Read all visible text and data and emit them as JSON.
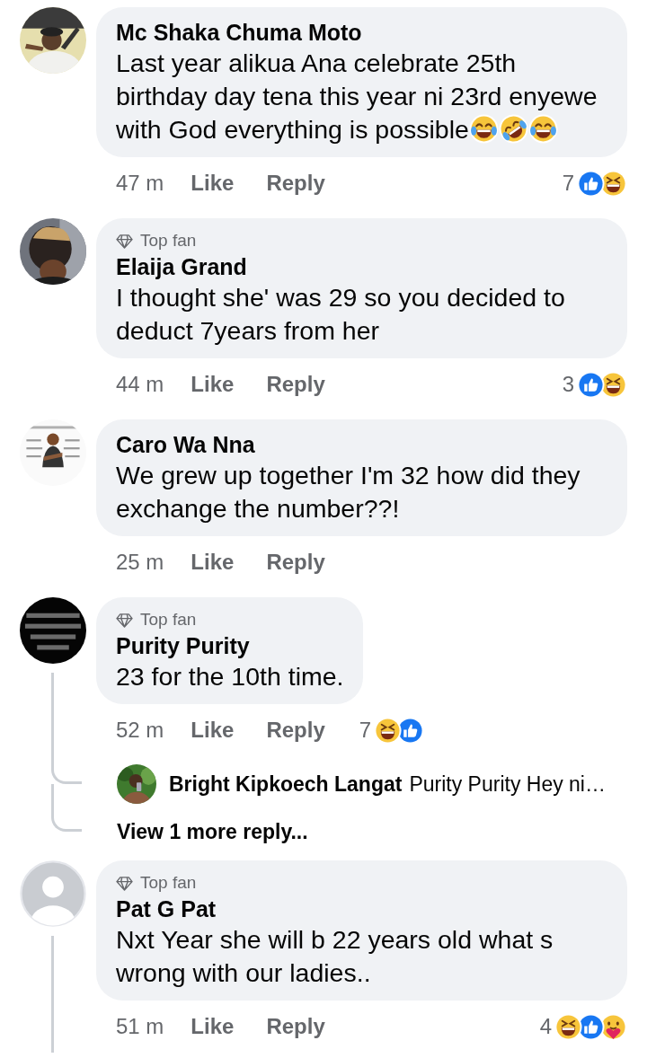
{
  "comments": [
    {
      "avatar": {
        "kind": "picture"
      },
      "name": "Mc Shaka Chuma Moto",
      "text": "Last year alikua Ana celebrate 25th birthday day tena this year ni 23rd enyewe with God everything is possible",
      "emojis": [
        {
          "kind": "joy"
        },
        {
          "kind": "rofl"
        },
        {
          "kind": "joy"
        }
      ],
      "time": "47 m",
      "like": "Like",
      "reply": "Reply",
      "reaction_count": "7",
      "reactions": [
        {
          "kind": "like"
        },
        {
          "kind": "haha"
        }
      ],
      "thread": false
    },
    {
      "avatar": {
        "kind": "picture"
      },
      "badge": "Top fan",
      "name": "Elaija Grand",
      "text": "I thought she' was 29 so you decided to deduct 7years from her",
      "time": "44 m",
      "like": "Like",
      "reply": "Reply",
      "reaction_count": "3",
      "reactions": [
        {
          "kind": "like"
        },
        {
          "kind": "haha"
        }
      ],
      "thread": false
    },
    {
      "avatar": {
        "kind": "picture"
      },
      "name": "Caro Wa Nna",
      "text": "We grew up together I'm 32 how did they exchange the number??!",
      "time": "25 m",
      "like": "Like",
      "reply": "Reply",
      "thread": false
    },
    {
      "avatar": {
        "kind": "picture"
      },
      "badge": "Top fan",
      "name": "Purity Purity",
      "text": "23 for the 10th time.",
      "time": "52 m",
      "like": "Like",
      "reply": "Reply",
      "reaction_count": "7",
      "reactions": [
        {
          "kind": "haha"
        },
        {
          "kind": "like"
        }
      ],
      "thread": true,
      "replies": [
        {
          "avatar": {
            "kind": "picture"
          },
          "name": "Bright Kipkoech Langat",
          "text": "Purity Purity Hey ni…"
        }
      ],
      "more_replies": "View 1 more reply..."
    },
    {
      "avatar": {
        "kind": "default"
      },
      "badge": "Top fan",
      "name": "Pat G Pat",
      "text": "Nxt Year she will  b 22 years old  what s wrong with our ladies..",
      "time": "51 m",
      "like": "Like",
      "reply": "Reply",
      "reaction_count": "4",
      "reactions": [
        {
          "kind": "haha"
        },
        {
          "kind": "like"
        },
        {
          "kind": "care"
        }
      ],
      "thread": true
    }
  ]
}
